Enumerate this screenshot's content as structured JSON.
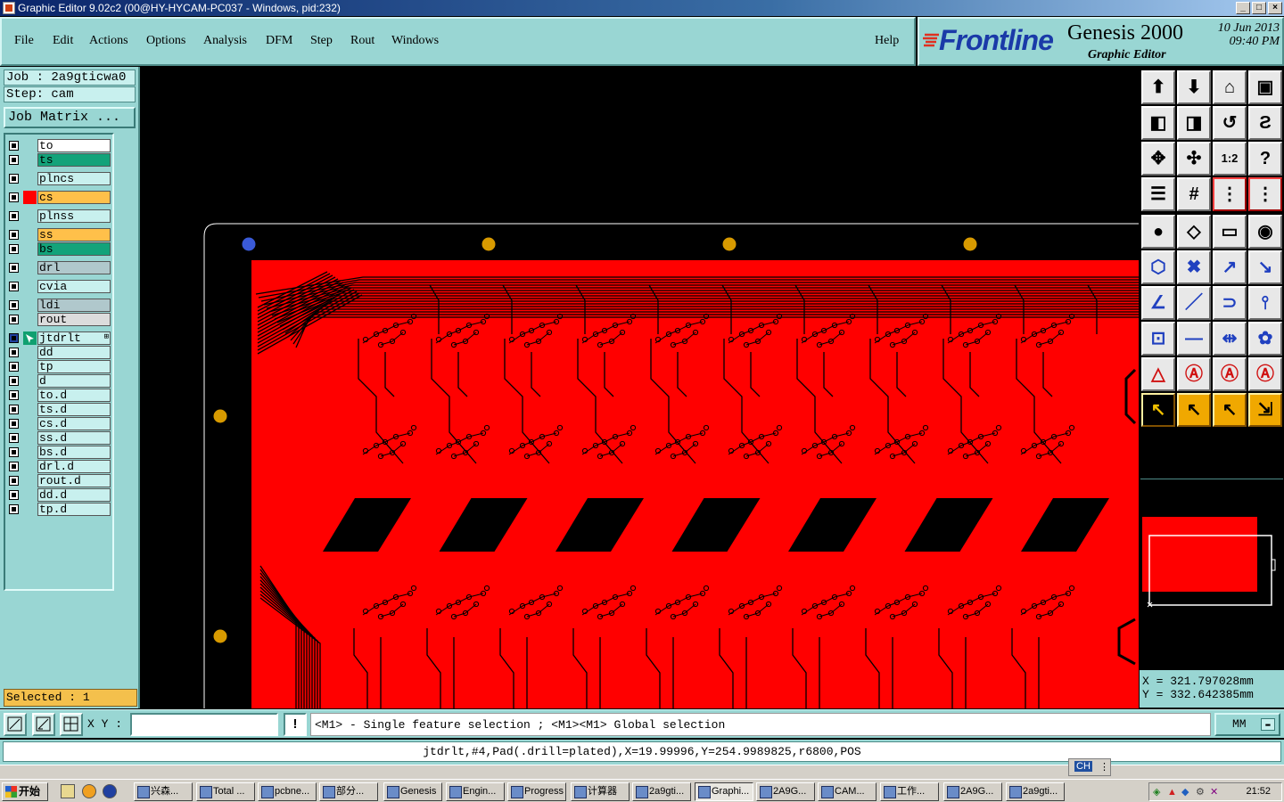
{
  "window": {
    "title": "Graphic Editor 9.02c2 (00@HY-HYCAM-PC037 - Windows, pid:232)"
  },
  "menu": [
    {
      "label": "File",
      "name": "menu-file"
    },
    {
      "label": "Edit",
      "name": "menu-edit"
    },
    {
      "label": "Actions",
      "name": "menu-actions"
    },
    {
      "label": "Options",
      "name": "menu-options"
    },
    {
      "label": "Analysis",
      "name": "menu-analysis"
    },
    {
      "label": "DFM",
      "name": "menu-dfm"
    },
    {
      "label": "Step",
      "name": "menu-step"
    },
    {
      "label": "Rout",
      "name": "menu-rout"
    },
    {
      "label": "Windows",
      "name": "menu-windows"
    },
    {
      "label": "Help",
      "name": "menu-help"
    }
  ],
  "branding": {
    "company": "Frontline",
    "product": "Genesis 2000",
    "module": "Graphic Editor",
    "date": "10 Jun 2013",
    "time": "09:40 PM"
  },
  "job": {
    "job_text": "Job : 2a9gticwa0",
    "step_text": "Step: cam",
    "matrix_button": "Job Matrix ..."
  },
  "layers": [
    {
      "name": "to",
      "color": "#ffffff"
    },
    {
      "name": "ts",
      "color": "#13a37a"
    },
    {
      "name": "plncs",
      "color": "#c8f0ee"
    },
    {
      "name": "cs",
      "color": "#ffc04a",
      "active_color": "#ff0000"
    },
    {
      "name": "plnss",
      "color": "#c8f0ee"
    },
    {
      "name": "ss",
      "color": "#ffc04a"
    },
    {
      "name": "bs",
      "color": "#13a37a"
    },
    {
      "name": "drl",
      "color": "#b0c8cc"
    },
    {
      "name": "cvia",
      "color": "#c8f0ee"
    },
    {
      "name": "ldi",
      "color": "#b0c8cc"
    },
    {
      "name": "rout",
      "color": "#dcdcdc"
    },
    {
      "name": "jtdrlt",
      "color": "#c8f0ee",
      "work": true
    },
    {
      "name": "dd",
      "color": "#c8f0ee"
    },
    {
      "name": "tp",
      "color": "#c8f0ee"
    },
    {
      "name": "d",
      "color": "#c8f0ee"
    },
    {
      "name": "to.d",
      "color": "#c8f0ee"
    },
    {
      "name": "ts.d",
      "color": "#c8f0ee"
    },
    {
      "name": "cs.d",
      "color": "#c8f0ee"
    },
    {
      "name": "ss.d",
      "color": "#c8f0ee"
    },
    {
      "name": "bs.d",
      "color": "#c8f0ee"
    },
    {
      "name": "drl.d",
      "color": "#c8f0ee"
    },
    {
      "name": "rout.d",
      "color": "#c8f0ee"
    },
    {
      "name": "dd.d",
      "color": "#c8f0ee"
    },
    {
      "name": "tp.d",
      "color": "#c8f0ee"
    }
  ],
  "selected_text": "Selected : 1",
  "coords": {
    "x": "X  =  321.797028mm",
    "y": "Y  =  332.642385mm"
  },
  "command": {
    "xy_label": "X Y :",
    "input_value": "",
    "warn_label": "!",
    "prompt": "<M1> - Single feature selection ; <M1><M1> Global selection",
    "units": "MM"
  },
  "feature_info": "jtdrlt,#4,Pad(.drill=plated),X=19.99996,Y=254.9989825,r6800,POS",
  "ime": "CH",
  "taskbar": {
    "start": "开始",
    "tasks": [
      "兴森...",
      "Total ...",
      "pcbne...",
      "部分...",
      "Genesis",
      "Engin...",
      "Progress",
      "计算器",
      "2a9gti...",
      "Graphi...",
      "2A9G...",
      "CAM...",
      "工作...",
      "2A9G...",
      "2a9gti..."
    ],
    "active_task": 9,
    "clock": "21:52"
  },
  "toolbar_icons": [
    "open-step-icon",
    "save-icon",
    "home-icon",
    "window-icon",
    "zoom-left-icon",
    "zoom-right-icon",
    "undo-zoom-icon",
    "redraw-icon",
    "fit-screen-icon",
    "zoom-center-icon",
    "scale-1-2-icon",
    "help-query-icon",
    "layers-config-icon",
    "grid-icon",
    "netlist-icon",
    "netlist-compare-icon",
    "add-pad-icon",
    "add-surface-icon",
    "ruler-icon",
    "circle-select-icon",
    "connect-icon",
    "delete-icon",
    "move-icon",
    "copy-icon",
    "angle-icon",
    "line-icon",
    "arc-icon",
    "flip-icon",
    "resize-icon",
    "cut-icon",
    "measure-icon",
    "shapes-icon",
    "warning-a-icon",
    "warning-b-icon",
    "warning-c-icon",
    "warning-d-icon",
    "pointer-icon",
    "pointer-select-icon",
    "pointer-pick-icon",
    "snap-icon"
  ],
  "colors": {
    "copper": "#ff0000",
    "hole": "#e0a000",
    "background": "#000000",
    "panel": "#99d6d3"
  }
}
